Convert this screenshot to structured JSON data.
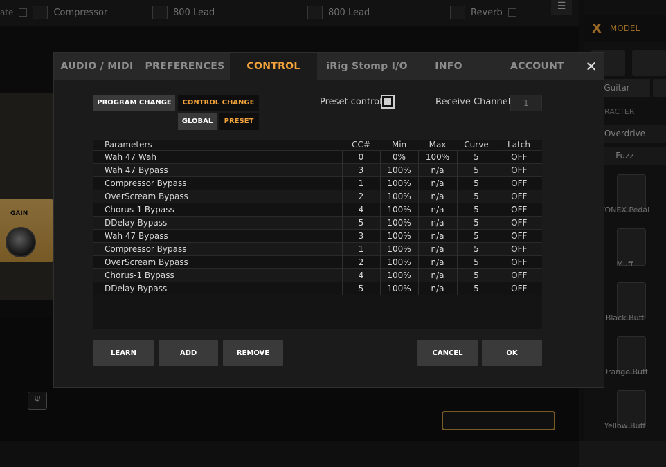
{
  "background": {
    "slots": [
      {
        "sub": "",
        "name": "Compressor",
        "prefix": "ate"
      },
      {
        "sub": "",
        "name": "800 Lead"
      },
      {
        "sub": "",
        "name": "800 Lead"
      },
      {
        "sub": "",
        "name": "Reverb"
      }
    ],
    "gain_label": "GAIN",
    "pedal_icon": "tuning-fork-icon"
  },
  "right_panel": {
    "model_label": "MODEL",
    "tabs": [
      "Guitar"
    ],
    "heading": "RACTER",
    "categories": [
      "Overdrive",
      "Fuzz"
    ],
    "models": [
      "TONEX Pedal",
      "Muff",
      "Black Buff",
      "Orange Buff",
      "Yellow Buff"
    ]
  },
  "dialog": {
    "tabs": [
      {
        "label": "AUDIO / MIDI",
        "active": false
      },
      {
        "label": "PREFERENCES",
        "active": false
      },
      {
        "label": "CONTROL",
        "active": true
      },
      {
        "label": "iRig Stomp I/O",
        "active": false
      },
      {
        "label": "INFO",
        "active": false
      },
      {
        "label": "ACCOUNT",
        "active": false
      }
    ],
    "close_label": "✕",
    "mode": {
      "program_change": "PROGRAM CHANGE",
      "control_change": "CONTROL CHANGE"
    },
    "scope": {
      "global": "GLOBAL",
      "preset": "PRESET"
    },
    "preset_control_label": "Preset control",
    "receive_channel_label": "Receive Channel",
    "receive_channel_value": "1",
    "table": {
      "headers": [
        "Parameters",
        "CC#",
        "Min",
        "Max",
        "Curve",
        "Latch"
      ],
      "rows": [
        [
          "Wah 47 Wah",
          "0",
          "0%",
          "100%",
          "5",
          "OFF"
        ],
        [
          "Wah 47 Bypass",
          "3",
          "100%",
          "n/a",
          "5",
          "OFF"
        ],
        [
          "Compressor Bypass",
          "1",
          "100%",
          "n/a",
          "5",
          "OFF"
        ],
        [
          "OverScream Bypass",
          "2",
          "100%",
          "n/a",
          "5",
          "OFF"
        ],
        [
          "Chorus-1 Bypass",
          "4",
          "100%",
          "n/a",
          "5",
          "OFF"
        ],
        [
          "DDelay Bypass",
          "5",
          "100%",
          "n/a",
          "5",
          "OFF"
        ],
        [
          "Wah 47 Bypass",
          "3",
          "100%",
          "n/a",
          "5",
          "OFF"
        ],
        [
          "Compressor Bypass",
          "1",
          "100%",
          "n/a",
          "5",
          "OFF"
        ],
        [
          "OverScream Bypass",
          "2",
          "100%",
          "n/a",
          "5",
          "OFF"
        ],
        [
          "Chorus-1 Bypass",
          "4",
          "100%",
          "n/a",
          "5",
          "OFF"
        ],
        [
          "DDelay Bypass",
          "5",
          "100%",
          "n/a",
          "5",
          "OFF"
        ]
      ]
    },
    "buttons": {
      "learn": "LEARN",
      "add": "ADD",
      "remove": "REMOVE",
      "cancel": "CANCEL",
      "ok": "OK"
    }
  },
  "colors": {
    "accent": "#f2a23b",
    "dialog_bg": "#1b1b1b",
    "button_bg": "#3a3a3a"
  }
}
